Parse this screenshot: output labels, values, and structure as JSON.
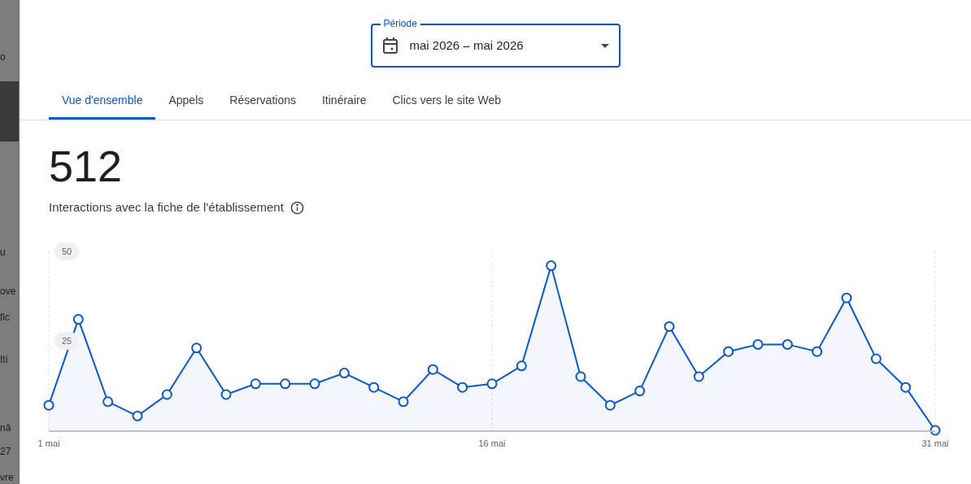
{
  "background_page": {
    "fragments": [
      "o",
      "u",
      "ove",
      "fic",
      "Iti",
      "nâ",
      "27",
      "vre"
    ]
  },
  "period": {
    "label": "Période",
    "value": "mai 2026 – mai 2026"
  },
  "tabs": [
    {
      "label": "Vue d'ensemble",
      "selected": true
    },
    {
      "label": "Appels",
      "selected": false
    },
    {
      "label": "Réservations",
      "selected": false
    },
    {
      "label": "Itinéraire",
      "selected": false
    },
    {
      "label": "Clics vers le site Web",
      "selected": false
    }
  ],
  "total": "512",
  "total_label": "Interactions avec la fiche de l'établissement",
  "chart": {
    "chart_data": {
      "type": "area",
      "x": [
        1,
        2,
        3,
        4,
        5,
        6,
        7,
        8,
        9,
        10,
        11,
        12,
        13,
        14,
        15,
        16,
        17,
        18,
        19,
        20,
        21,
        22,
        23,
        24,
        25,
        26,
        27,
        28,
        29,
        30,
        31
      ],
      "series": [
        {
          "color": "#0b57d0",
          "values": [
            7,
            31,
            8,
            4,
            10,
            23,
            10,
            13,
            13,
            13,
            16,
            12,
            8,
            17,
            12,
            13,
            18,
            46,
            15,
            7,
            11,
            29,
            15,
            22,
            24,
            24,
            22,
            37,
            20,
            12,
            0
          ]
        }
      ],
      "xlim": [
        1,
        31
      ],
      "ylim": [
        0,
        50
      ],
      "yticks": [
        25,
        50
      ],
      "xticks": [
        {
          "value": 1,
          "label": "1 mai"
        },
        {
          "value": 16,
          "label": "16 mai"
        },
        {
          "value": 31,
          "label": "31 mai"
        }
      ]
    }
  }
}
